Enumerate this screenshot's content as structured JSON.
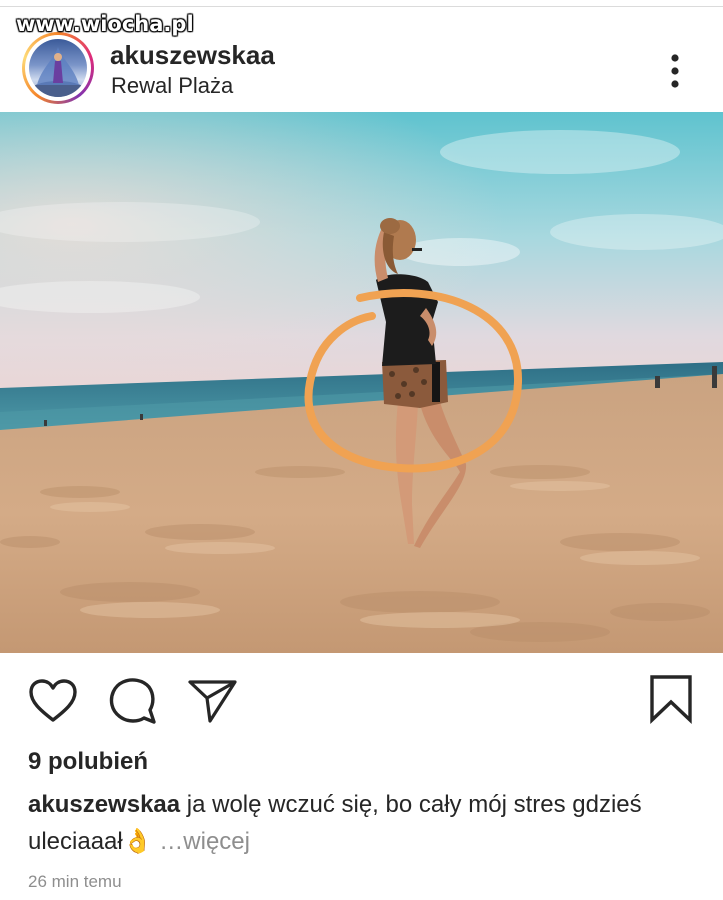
{
  "watermark": "www.wiocha.pl",
  "post_header": {
    "username": "akuszewskaa",
    "location": "Rewal Plaża",
    "more_icon": "more-vertical-icon"
  },
  "photo": {
    "subject": "woman-on-beach",
    "annotation_color": "#f0a252"
  },
  "actions": {
    "like_icon": "heart-icon",
    "comment_icon": "comment-icon",
    "share_icon": "send-icon",
    "save_icon": "bookmark-icon"
  },
  "likes_text": "9 polubień",
  "caption": {
    "username": "akuszewskaa",
    "text": " ja wolę wczuć się, bo cały mój stres gdzieś uleciaaał",
    "emoji": "👌",
    "more": " …więcej"
  },
  "timestamp": "26 min temu"
}
